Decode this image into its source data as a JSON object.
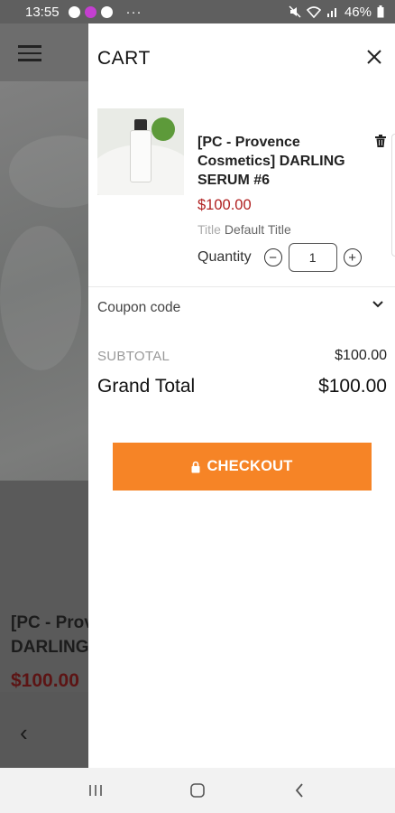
{
  "status_bar": {
    "time": "13:55",
    "battery": "46%"
  },
  "cart": {
    "title": "CART",
    "item": {
      "name": "[PC - Provence Cosmetics] DARLING SERUM #6",
      "price": "$100.00",
      "variant_label": "Title",
      "variant_value": "Default Title",
      "quantity_label": "Quantity",
      "quantity": "1"
    },
    "coupon_label": "Coupon code",
    "subtotal_label": "SUBTOTAL",
    "subtotal_value": "$100.00",
    "grand_total_label": "Grand Total",
    "grand_total_value": "$100.00",
    "checkout_label": "CHECKOUT"
  },
  "background_page": {
    "product_title_line1": "[PC - Prov",
    "product_title_line2": "DARLING",
    "product_price": "$100.00"
  },
  "colors": {
    "accent": "#f68426",
    "price": "#b02020"
  },
  "icons": [
    "hamburger-icon",
    "close-icon",
    "trash-icon",
    "minus-icon",
    "plus-icon",
    "chevron-down-icon",
    "lock-icon",
    "back-icon"
  ]
}
